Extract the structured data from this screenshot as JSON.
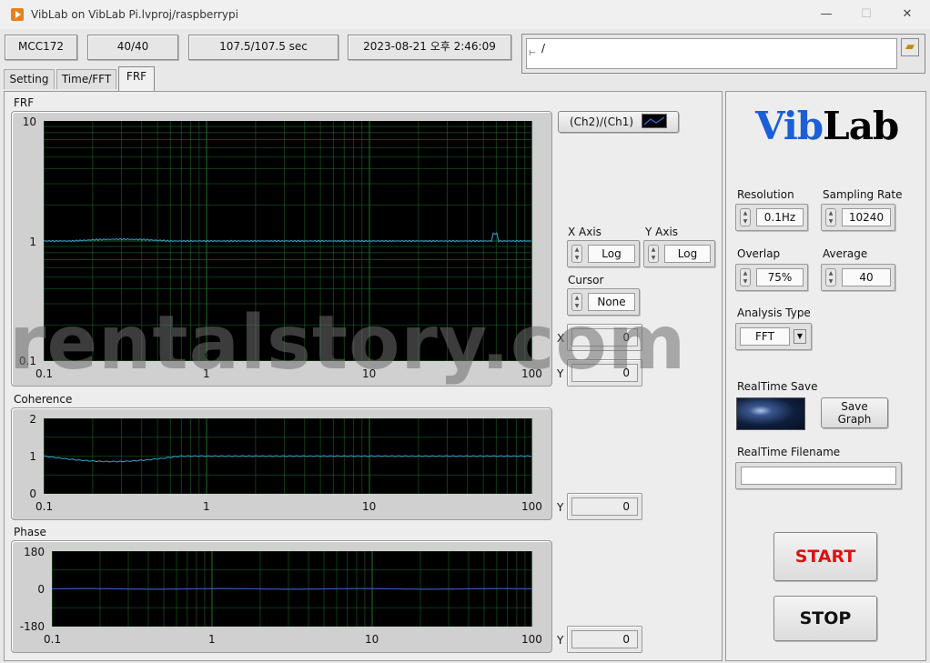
{
  "window": {
    "title": "VibLab on VibLab Pi.lvproj/raspberrypi",
    "minimize": "—",
    "maximize": "☐",
    "close": "✕"
  },
  "status_bar": {
    "device": "MCC172",
    "count": "40/40",
    "time": "107.5/107.5 sec",
    "datetime": "2023-08-21 오후 2:46:09",
    "path": "/"
  },
  "tabs": [
    "Setting",
    "Time/FFT",
    "FRF"
  ],
  "active_tab": "FRF",
  "graphs": {
    "frf": {
      "label": "FRF",
      "y_ticks": [
        "10",
        "1",
        "0.1"
      ],
      "x_ticks": [
        "0.1",
        "1",
        "10",
        "100"
      ],
      "legend": "(Ch2)/(Ch1)"
    },
    "coherence": {
      "label": "Coherence",
      "y_ticks": [
        "2",
        "1",
        "0"
      ],
      "x_ticks": [
        "0.1",
        "1",
        "10",
        "100"
      ]
    },
    "phase": {
      "label": "Phase",
      "y_ticks": [
        "180",
        "0",
        "-180"
      ],
      "x_ticks": [
        "0.1",
        "1",
        "10",
        "100"
      ]
    }
  },
  "graph_controls": {
    "x_axis_label": "X Axis",
    "x_axis_value": "Log",
    "y_axis_label": "Y Axis",
    "y_axis_value": "Log",
    "cursor_label": "Cursor",
    "cursor_value": "None",
    "x_label": "X",
    "x_value": "0",
    "y_label": "Y",
    "frf_y_value": "0",
    "coherence_y_value": "0",
    "phase_y_value": "0"
  },
  "logo": {
    "part1": "Vib",
    "part2": "Lab"
  },
  "settings": {
    "resolution_label": "Resolution",
    "resolution_value": "0.1Hz",
    "sampling_rate_label": "Sampling Rate",
    "sampling_rate_value": "10240",
    "overlap_label": "Overlap",
    "overlap_value": "75%",
    "average_label": "Average",
    "average_value": "40",
    "analysis_type_label": "Analysis Type",
    "analysis_type_value": "FFT",
    "realtime_save_label": "RealTime Save",
    "save_graph_label": "Save\nGraph",
    "realtime_filename_label": "RealTime Filename",
    "realtime_filename_value": ""
  },
  "buttons": {
    "start": "START",
    "stop": "STOP"
  },
  "watermark": "rentalstory.com",
  "colors": {
    "plot_bg": "#000000",
    "grid": "#1f6b2a",
    "trace": "#3aa0d0",
    "start_text": "#e01010",
    "logo_blue": "#1a5fd8",
    "logo_black": "#000000"
  }
}
